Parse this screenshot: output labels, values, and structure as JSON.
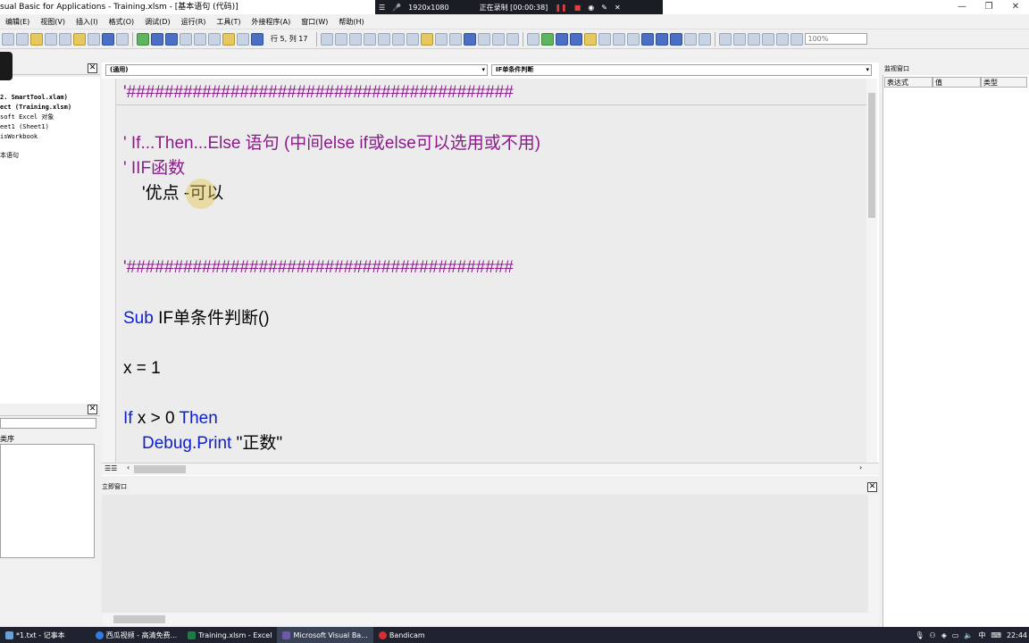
{
  "window": {
    "title": "sual Basic for Applications - Training.xlsm - [基本语句 (代码)]"
  },
  "recorder": {
    "resolution": "1920x1080",
    "status": "正在录制 [00:00:38]"
  },
  "menu": [
    "编辑(E)",
    "视图(V)",
    "插入(I)",
    "格式(O)",
    "调试(D)",
    "运行(R)",
    "工具(T)",
    "外接程序(A)",
    "窗口(W)",
    "帮助(H)"
  ],
  "toolbar": {
    "position_label": "行 5, 列 17",
    "zoom": "100%"
  },
  "project": {
    "items": [
      "2. SmartTool.xlam)",
      "ect (Training.xlsm)",
      "soft Excel 对象",
      "eet1 (Sheet1)",
      "isWorkbook",
      "本语句"
    ]
  },
  "properties": {
    "tab_label": "类序"
  },
  "code": {
    "object_combo": "(通用)",
    "proc_combo": "IF单条件判断",
    "lines": [
      {
        "text": "'#########################################",
        "kind": "cmt"
      },
      {
        "text": "' If...Then...Else 语句 (中间else if或else可以选用或不用)",
        "kind": "cmt"
      },
      {
        "text": "' IIF函数",
        "kind": "cmt"
      },
      {
        "text": "'优点 -可以",
        "kind": "plain"
      },
      {
        "text": "'#########################################",
        "kind": "cmt"
      },
      {
        "kw": "Sub",
        "rest": " IF单条件判断()"
      },
      {
        "text": "x = 1",
        "kind": "plain"
      },
      {
        "kw": "If",
        "mid": " x > 0 ",
        "kw2": "Then"
      },
      {
        "kw": "Debug.Print",
        "rest": " \"正数\""
      }
    ]
  },
  "immediate": {
    "title": "立即窗口"
  },
  "watch": {
    "title": "监视窗口",
    "columns": [
      "表达式",
      "值",
      "类型"
    ]
  },
  "taskbar": {
    "tasks": [
      "*1.txt - 记事本",
      "西瓜视频 - 高清免费...",
      "Training.xlsm - Excel",
      "Microsoft Visual Ba...",
      "Bandicam"
    ],
    "tray_lang": "中",
    "clock": "22:44"
  },
  "colors": {
    "comment": "#8b1a8b",
    "keyword": "#1020c8"
  }
}
